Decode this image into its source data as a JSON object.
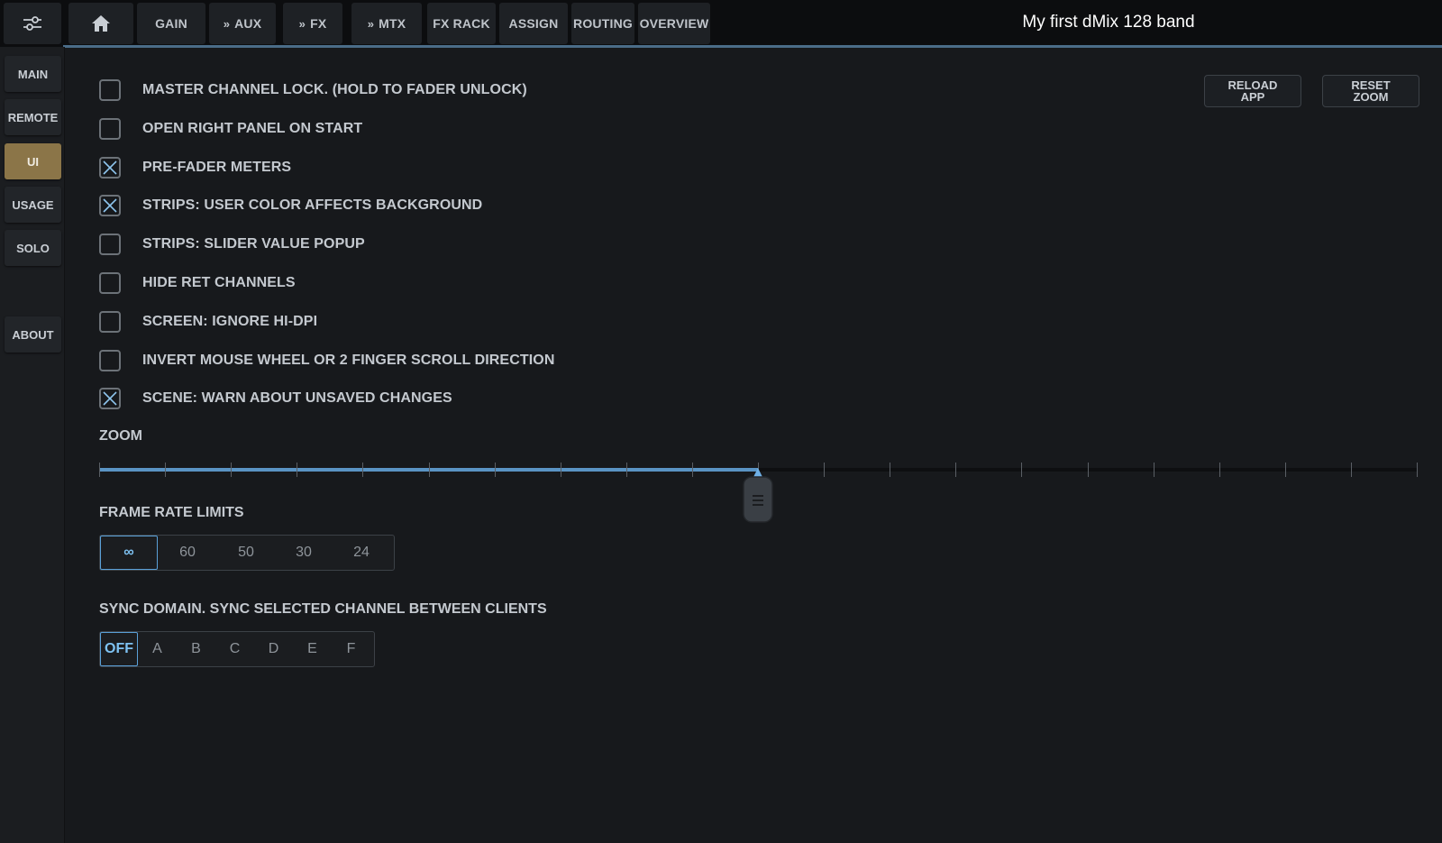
{
  "header": {
    "menu_icon": "sliders-icon",
    "home_icon": "home-icon",
    "tabs": [
      {
        "label": "GAIN",
        "chevron": false
      },
      {
        "label": "AUX",
        "chevron": true
      },
      {
        "label": "FX",
        "chevron": true
      },
      {
        "label": "MTX",
        "chevron": true
      },
      {
        "label": "FX RACK",
        "chevron": false
      },
      {
        "label": "ASSIGN",
        "chevron": false
      },
      {
        "label": "ROUTING",
        "chevron": false
      },
      {
        "label": "OVERVIEW",
        "chevron": false
      }
    ],
    "chevron_glyph": "»",
    "title": "My first dMix 128 band"
  },
  "sidebar": {
    "items": [
      "MAIN",
      "REMOTE",
      "UI",
      "USAGE",
      "SOLO",
      "ABOUT"
    ],
    "active": "UI"
  },
  "options": [
    {
      "label": "MASTER CHANNEL LOCK. (HOLD TO FADER UNLOCK)",
      "checked": false
    },
    {
      "label": "OPEN RIGHT PANEL ON START",
      "checked": false
    },
    {
      "label": "PRE-FADER METERS",
      "checked": true
    },
    {
      "label": "STRIPS: USER COLOR AFFECTS BACKGROUND",
      "checked": true
    },
    {
      "label": "STRIPS: SLIDER VALUE POPUP",
      "checked": false
    },
    {
      "label": "HIDE RET CHANNELS",
      "checked": false
    },
    {
      "label": "SCREEN: IGNORE HI-DPI",
      "checked": false
    },
    {
      "label": "INVERT MOUSE WHEEL OR 2 FINGER SCROLL DIRECTION",
      "checked": false
    },
    {
      "label": "SCENE: WARN ABOUT UNSAVED CHANGES",
      "checked": true
    }
  ],
  "actions": {
    "reload": [
      "RELOAD",
      "APP"
    ],
    "reset_zoom": [
      "RESET",
      "ZOOM"
    ]
  },
  "zoom": {
    "label": "ZOOM",
    "value_fraction": 0.5,
    "tick_count": 21
  },
  "frame_rate": {
    "label": "FRAME RATE LIMITS",
    "options": [
      "∞",
      "60",
      "50",
      "30",
      "24"
    ],
    "selected": "∞"
  },
  "sync_domain": {
    "label": "SYNC DOMAIN. SYNC SELECTED CHANNEL BETWEEN CLIENTS",
    "options": [
      "OFF",
      "A",
      "B",
      "C",
      "D",
      "E",
      "F"
    ],
    "selected": "OFF"
  },
  "colors": {
    "accent_blue": "#5a94c4",
    "active_gold": "#8b7548",
    "background": "#17191c"
  }
}
